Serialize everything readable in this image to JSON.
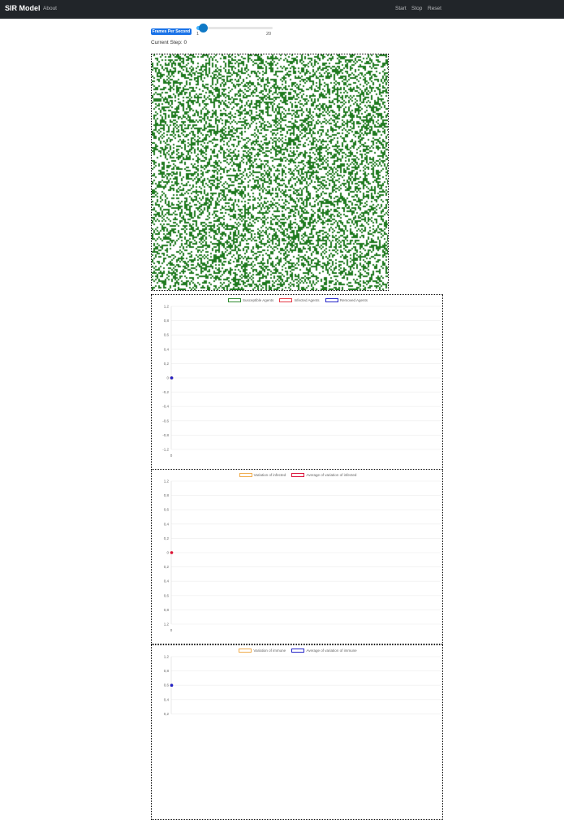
{
  "navbar": {
    "brand": "SIR Model",
    "about": "About",
    "start": "Start",
    "stop": "Stop",
    "reset": "Reset"
  },
  "controls": {
    "fps_badge": "Frames Per Second",
    "slider_min": "1",
    "slider_max": "20",
    "slider_value": 2,
    "current_step": "Current Step: 0"
  },
  "colors": {
    "navbar": "#212529",
    "agent": "#1f7a1f",
    "susceptible": "#2e8b2e",
    "infected": "#e63946",
    "removed": "#2323c8",
    "orange": "#f0ad4e",
    "crimson": "#dc143c",
    "grid": "#e6e6e6"
  },
  "chart_data": [
    {
      "type": "line",
      "legend": [
        "Susceptible Agents",
        "Infected Agents",
        "Removed Agents"
      ],
      "x": [
        0
      ],
      "series": [
        {
          "name": "Susceptible Agents",
          "values": [
            0
          ]
        },
        {
          "name": "Infected Agents",
          "values": [
            0
          ]
        },
        {
          "name": "Removed Agents",
          "values": [
            0
          ]
        }
      ],
      "yticks": [
        "1,2",
        "0,8",
        "0,6",
        "0,4",
        "0,2",
        "0",
        "-0,2",
        "-0,4",
        "-0,6",
        "-0,8",
        "-1,2"
      ],
      "xticks": [
        "0"
      ]
    },
    {
      "type": "line",
      "legend": [
        "Variation of infected",
        "Average of variation of infected"
      ],
      "x": [
        0
      ],
      "series": [
        {
          "name": "Variation of infected",
          "values": [
            0
          ]
        },
        {
          "name": "Average of variation of infected",
          "values": [
            0
          ]
        }
      ],
      "yticks": [
        "1,2",
        "0,8",
        "0,6",
        "0,4",
        "0,2",
        "0",
        "0,2",
        "0,4",
        "0,6",
        "0,8",
        "1,2"
      ],
      "xticks": [
        "0"
      ]
    },
    {
      "type": "line",
      "legend": [
        "Variation of immune",
        "Average of variation of immune"
      ],
      "x": [
        0
      ],
      "series": [
        {
          "name": "Variation of immune",
          "values": [
            0
          ]
        },
        {
          "name": "Average of variation of immune",
          "values": [
            0
          ]
        }
      ],
      "yticks": [
        "1,2",
        "0,8",
        "0,6",
        "0,4",
        "0,2"
      ],
      "xticks": []
    }
  ]
}
